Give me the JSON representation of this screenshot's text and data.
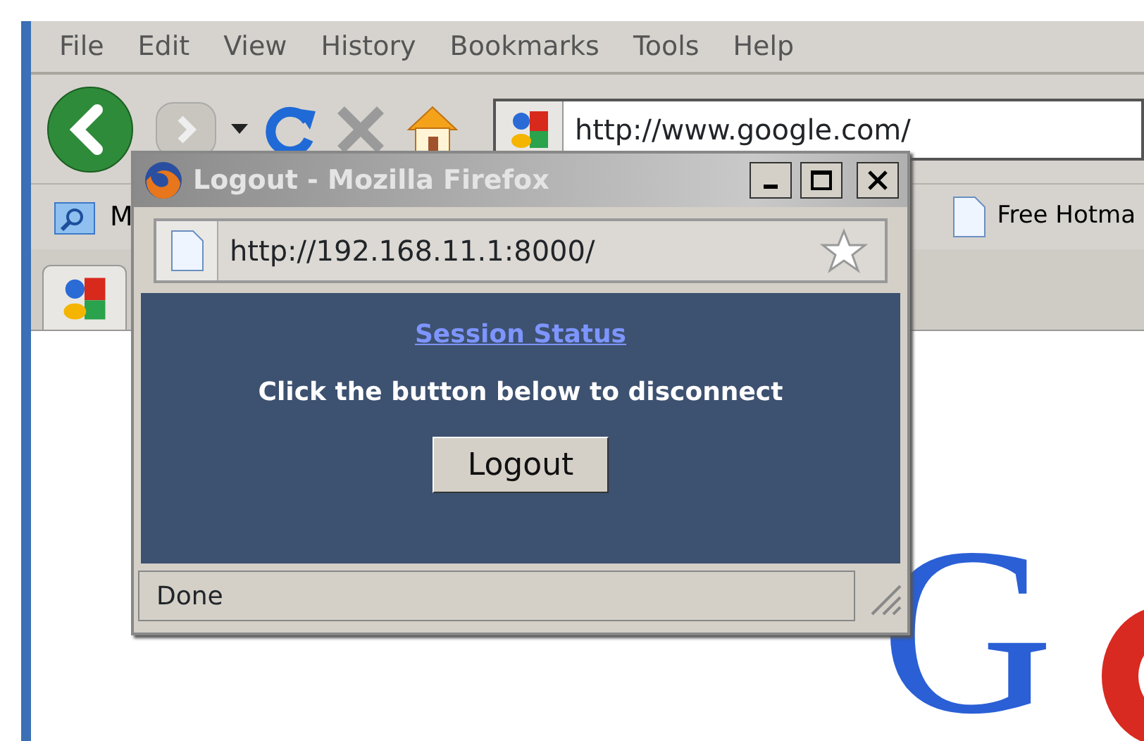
{
  "menu": [
    "File",
    "Edit",
    "View",
    "History",
    "Bookmarks",
    "Tools",
    "Help"
  ],
  "toolbar": {
    "url": "http://www.google.com/"
  },
  "bookmarks": [
    "M",
    "Free Hotma"
  ],
  "page": {
    "logo": "G"
  },
  "popup": {
    "title": "Logout - Mozilla Firefox",
    "url": "http://192.168.11.1:8000/",
    "link": "Session Status",
    "message": "Click the button below to disconnect",
    "button": "Logout",
    "status": "Done"
  }
}
